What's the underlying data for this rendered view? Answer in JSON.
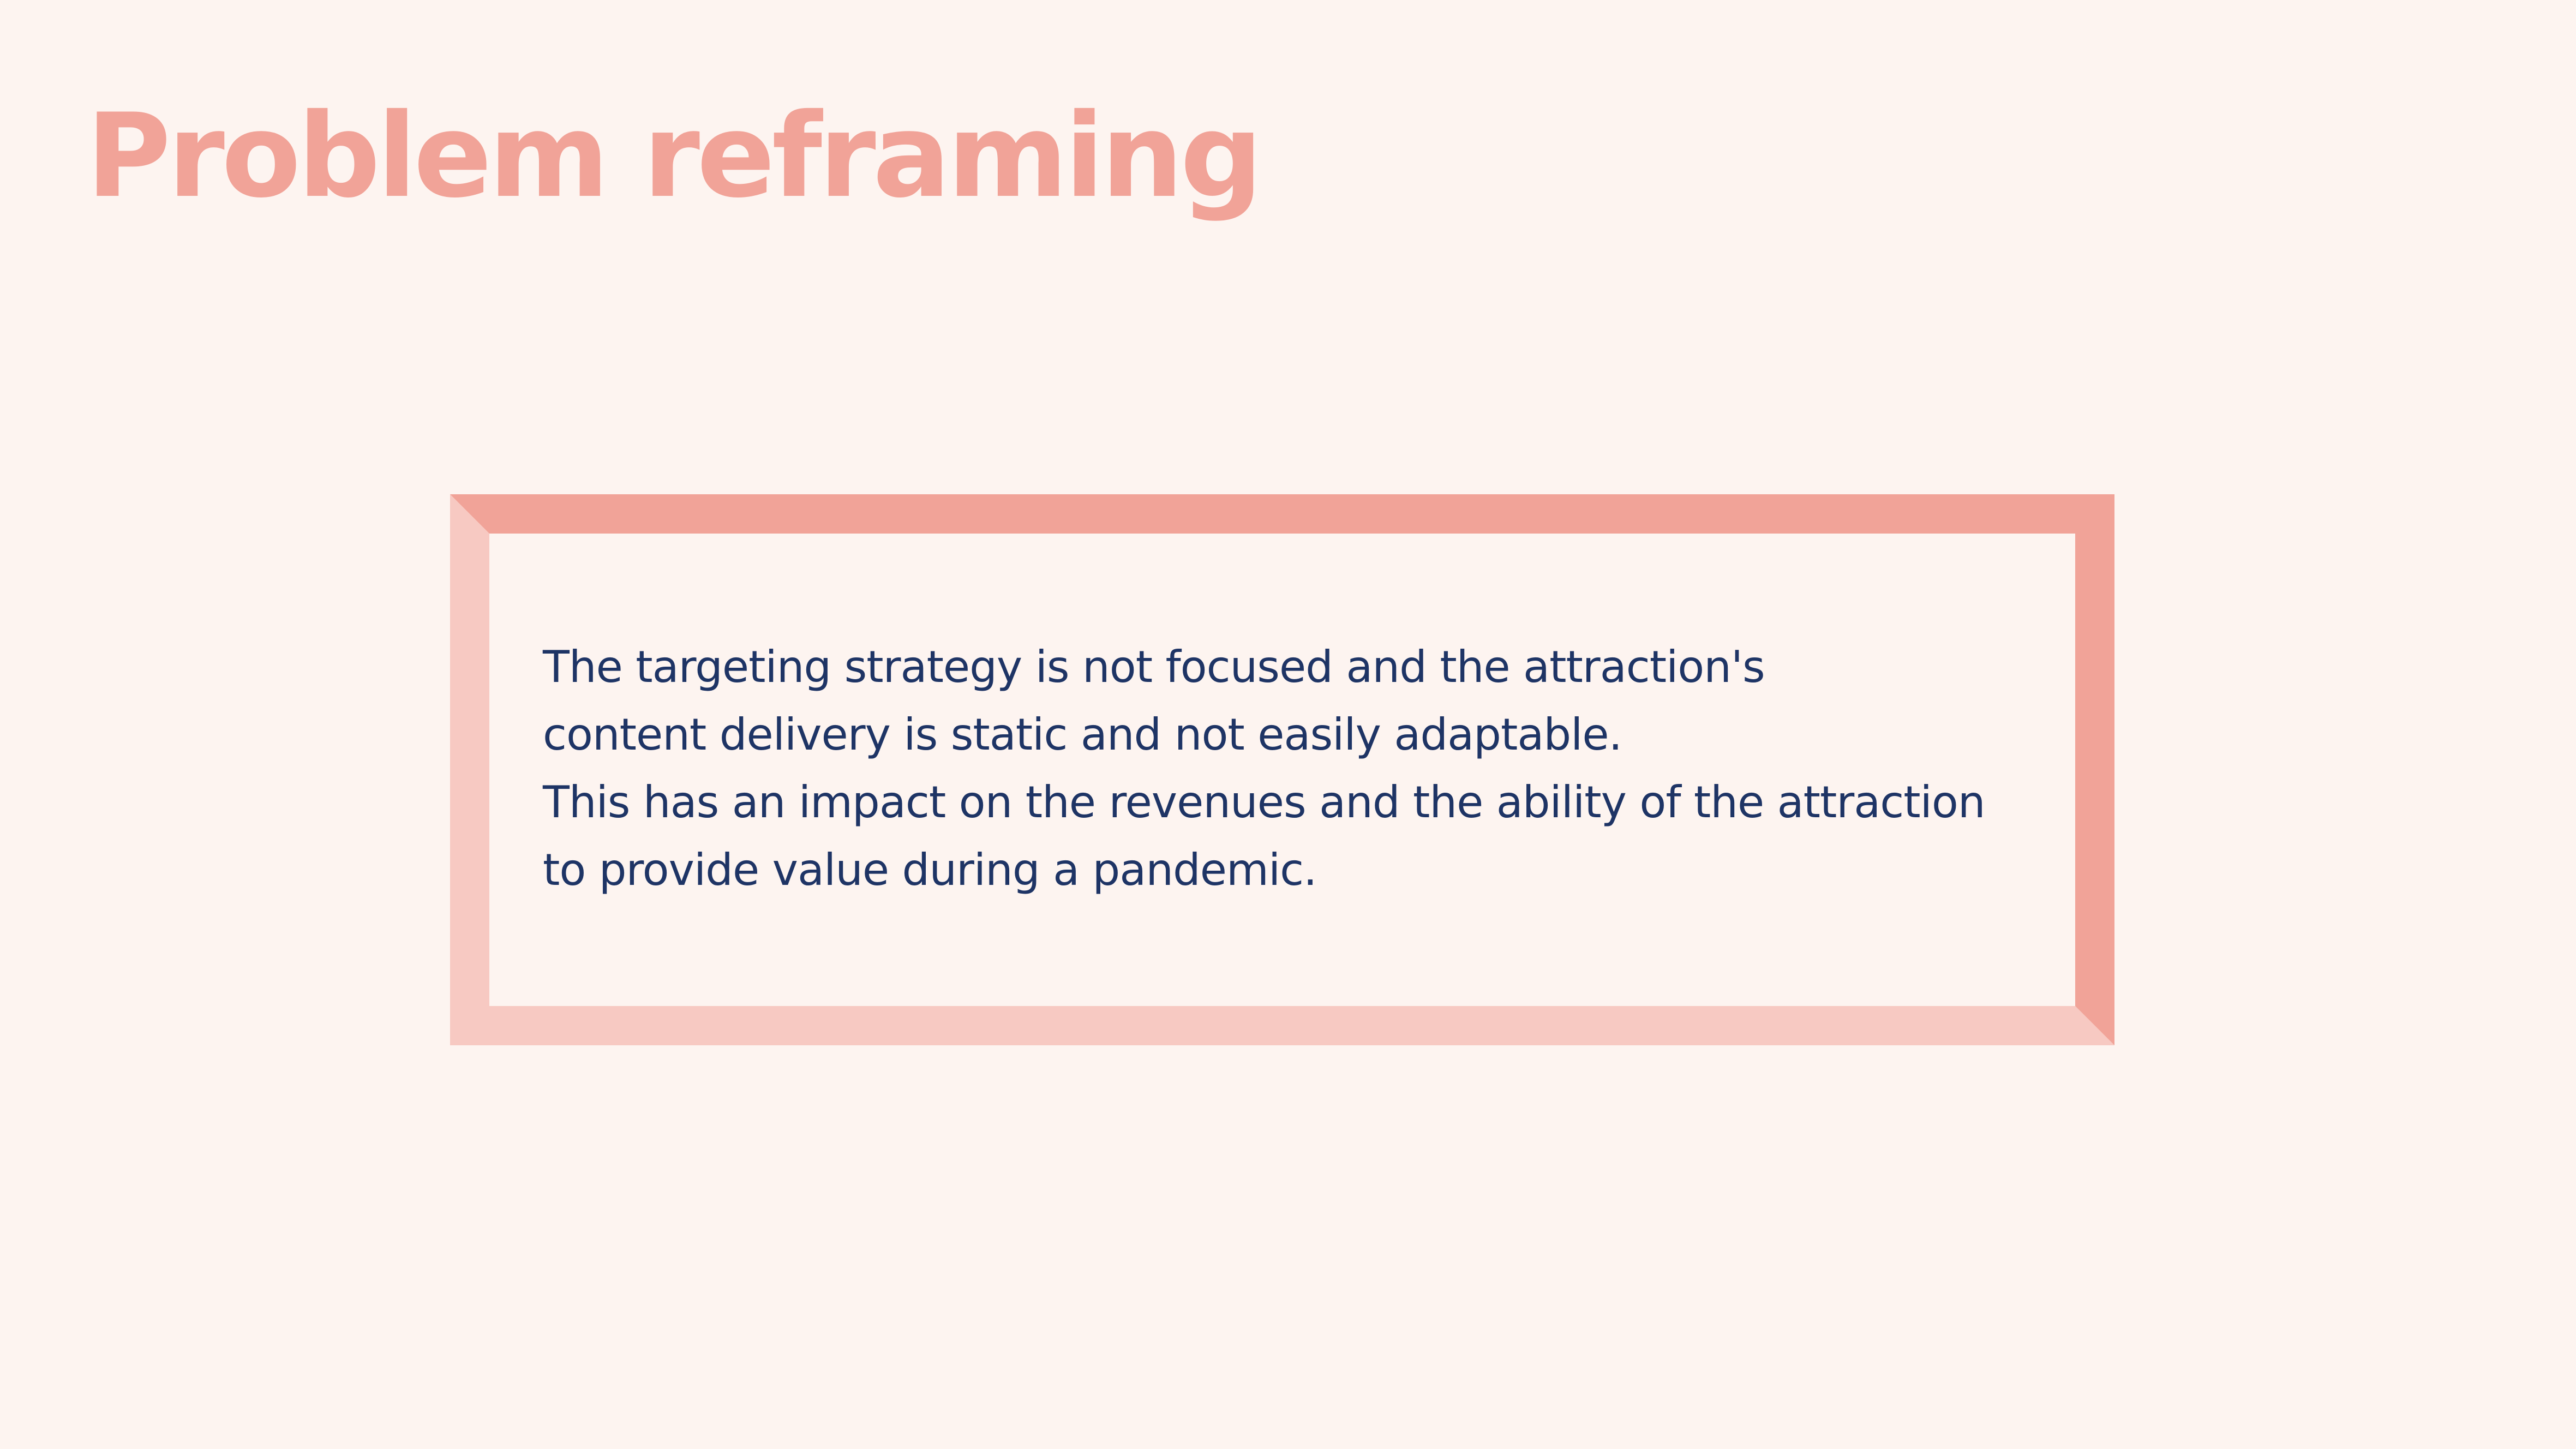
{
  "slide": {
    "title": "Problem reframing",
    "statement_lines": [
      "The targeting strategy is not focused and the attraction's",
      "content delivery is static and not easily adaptable.",
      "This has an impact on the revenues and the ability of the attraction",
      "to provide value during a pandemic."
    ]
  },
  "colors": {
    "background": "#fdf4f0",
    "title": "#f1a398",
    "frame_dark": "#f1a398",
    "frame_light": "#f7c9c2",
    "frame_inner": "#fdf4f0",
    "text": "#1e3465"
  }
}
